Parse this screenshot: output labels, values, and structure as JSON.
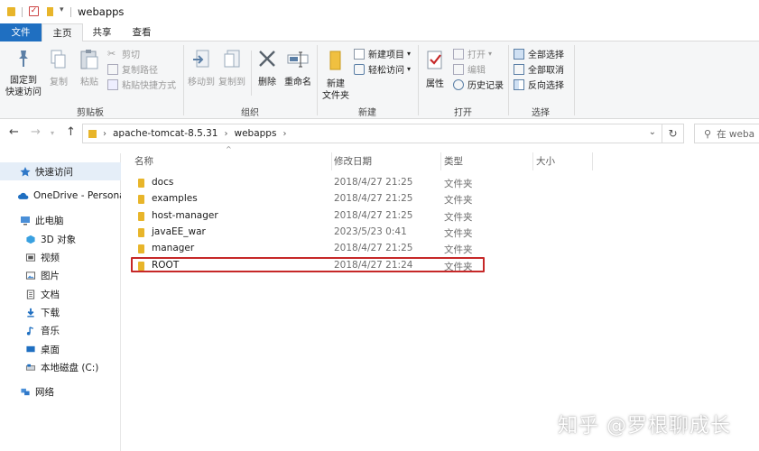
{
  "window": {
    "title": "webapps"
  },
  "tabs": [
    "文件",
    "主页",
    "共享",
    "查看"
  ],
  "ribbon": {
    "clipboard": {
      "pin_label": "固定到\n快速访问",
      "copy_label": "复制",
      "paste_label": "粘贴",
      "cut_label": "剪切",
      "copy_path_label": "复制路径",
      "paste_shortcut_label": "粘贴快捷方式",
      "group_label": "剪贴板"
    },
    "organize": {
      "move_to_label": "移动到",
      "copy_to_label": "复制到",
      "delete_label": "删除",
      "rename_label": "重命名",
      "group_label": "组织"
    },
    "new": {
      "new_folder_label": "新建\n文件夹",
      "new_item_label": "新建项目",
      "easy_access_label": "轻松访问",
      "group_label": "新建"
    },
    "open": {
      "properties_label": "属性",
      "open_label": "打开",
      "edit_label": "编辑",
      "history_label": "历史记录",
      "group_label": "打开"
    },
    "select": {
      "select_all_label": "全部选择",
      "select_none_label": "全部取消",
      "invert_label": "反向选择",
      "group_label": "选择"
    }
  },
  "address": {
    "crumbs": [
      "apache-tomcat-8.5.31",
      "webapps"
    ],
    "search_placeholder": "在 weba"
  },
  "navpane": {
    "items": [
      {
        "label": "快速访问",
        "icon": "star-icon"
      },
      {
        "label": "OneDrive - Persona",
        "icon": "cloud-icon"
      },
      {
        "label": "此电脑",
        "icon": "computer-icon"
      },
      {
        "label": "3D 对象",
        "icon": "cube-icon"
      },
      {
        "label": "视频",
        "icon": "video-icon"
      },
      {
        "label": "图片",
        "icon": "picture-icon"
      },
      {
        "label": "文档",
        "icon": "document-icon"
      },
      {
        "label": "下载",
        "icon": "download-icon"
      },
      {
        "label": "音乐",
        "icon": "music-icon"
      },
      {
        "label": "桌面",
        "icon": "desktop-icon"
      },
      {
        "label": "本地磁盘 (C:)",
        "icon": "drive-icon"
      },
      {
        "label": "网络",
        "icon": "network-icon"
      }
    ]
  },
  "filelist": {
    "columns": [
      "名称",
      "修改日期",
      "类型",
      "大小"
    ],
    "rows": [
      {
        "name": "docs",
        "date": "2018/4/27 21:25",
        "type": "文件夹"
      },
      {
        "name": "examples",
        "date": "2018/4/27 21:25",
        "type": "文件夹"
      },
      {
        "name": "host-manager",
        "date": "2018/4/27 21:25",
        "type": "文件夹"
      },
      {
        "name": "javaEE_war",
        "date": "2023/5/23 0:41",
        "type": "文件夹"
      },
      {
        "name": "manager",
        "date": "2018/4/27 21:25",
        "type": "文件夹"
      },
      {
        "name": "ROOT",
        "date": "2018/4/27 21:24",
        "type": "文件夹"
      }
    ]
  },
  "watermark": "知乎 @罗根聊成长",
  "colors": {
    "accent": "#1f6fc1",
    "folder": "#e8b52a",
    "highlight": "#c62828"
  }
}
